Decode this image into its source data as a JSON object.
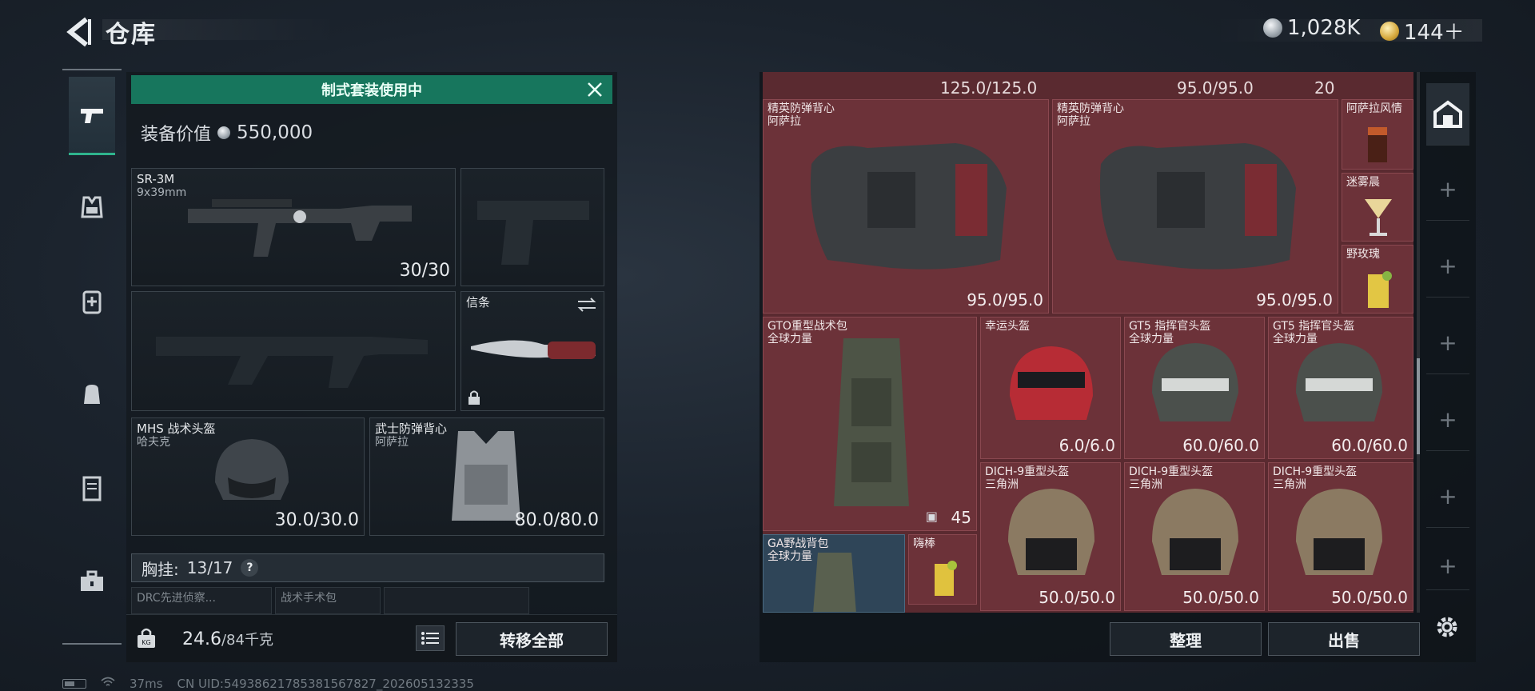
{
  "header": {
    "title": "仓库",
    "currency": [
      {
        "amount": "1,028K",
        "icon": "silver-coin-icon"
      },
      {
        "amount": "144＋",
        "icon": "gold-coin-icon"
      }
    ]
  },
  "left_nav": {
    "items": [
      {
        "name": "weapons",
        "icon": "pistol-icon",
        "active": true
      },
      {
        "name": "armor",
        "icon": "vest-icon"
      },
      {
        "name": "medical",
        "icon": "medkit-icon"
      },
      {
        "name": "backpack",
        "icon": "backpack-icon"
      },
      {
        "name": "storage",
        "icon": "locker-icon"
      },
      {
        "name": "toolbox",
        "icon": "toolbox-icon"
      }
    ]
  },
  "loadout": {
    "banner": "制式套装使用中",
    "equip_value_label": "装备价值",
    "equip_value": "550,000",
    "primary": {
      "name": "SR-3M",
      "ammo": "9x39mm",
      "count": "30/30"
    },
    "knife": {
      "name": "信条"
    },
    "helmet": {
      "name": "MHS 战术头盔",
      "sub": "哈夫克",
      "durability": "30.0/30.0"
    },
    "vest": {
      "name": "武士防弹背心",
      "sub": "阿萨拉",
      "durability": "80.0/80.0"
    },
    "chest_rig": {
      "label": "胸挂:",
      "capacity": "13/17",
      "help": "?"
    },
    "mini_slots": [
      "DRC先进侦察...",
      "战术手术包",
      ""
    ],
    "weight": {
      "current": "24.6",
      "max": "/84千克"
    },
    "transfer_all": "转移全部"
  },
  "status": {
    "ping": "37ms",
    "uid": "CN UID:5493862178538156782​7_202605132335"
  },
  "storage": {
    "top_partials": [
      "125.0/125.0",
      "95.0/95.0",
      "20"
    ],
    "items": [
      {
        "name": "精英防弹背心",
        "sub": "阿萨拉",
        "value": "95.0/95.0"
      },
      {
        "name": "精英防弹背心",
        "sub": "阿萨拉",
        "value": "95.0/95.0"
      },
      {
        "name": "阿萨拉风情",
        "sub": "",
        "value": ""
      },
      {
        "name": "迷雾晨",
        "sub": "",
        "value": ""
      },
      {
        "name": "野玫瑰",
        "sub": "",
        "value": ""
      },
      {
        "name": "GTO重型战术包",
        "sub": "全球力量",
        "value": "45"
      },
      {
        "name": "幸运头盔",
        "sub": "",
        "value": "6.0/6.0"
      },
      {
        "name": "GT5 指挥官头盔",
        "sub": "全球力量",
        "value": "60.0/60.0"
      },
      {
        "name": "GT5 指挥官头盔",
        "sub": "全球力量",
        "value": "60.0/60.0"
      },
      {
        "name": "DICH-9重型头盔",
        "sub": "三角洲",
        "value": "50.0/50.0"
      },
      {
        "name": "DICH-9重型头盔",
        "sub": "三角洲",
        "value": "50.0/50.0"
      },
      {
        "name": "DICH-9重型头盔",
        "sub": "三角洲",
        "value": "50.0/50.0"
      },
      {
        "name": "GA野战背包",
        "sub": "全球力量",
        "value": ""
      },
      {
        "name": "嗨棒",
        "sub": "",
        "value": ""
      }
    ],
    "sort": "整理",
    "sell": "出售"
  },
  "right_rail": {
    "items": [
      "storage-house-icon",
      "+",
      "+",
      "+",
      "+",
      "+",
      "+"
    ]
  }
}
